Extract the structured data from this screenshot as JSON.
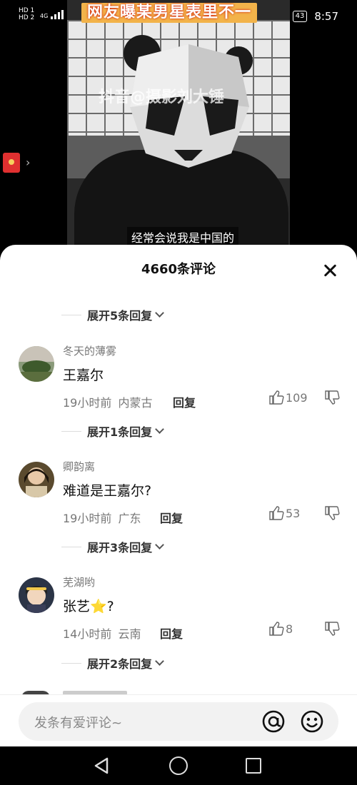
{
  "status_bar": {
    "hd1": "HD 1",
    "hd2": "HD 2",
    "network": "4G",
    "battery": "43",
    "time": "8:57"
  },
  "video": {
    "title_banner": "网友曝某男星表里不一",
    "watermark": "抖音@摄影刘大锤",
    "caption": "经常会说我是中国的"
  },
  "comments_sheet": {
    "header": "4660条评论",
    "expand_labels": [
      "展开5条回复",
      "展开1条回复",
      "展开3条回复",
      "展开2条回复"
    ],
    "comments": [
      {
        "user": "冬天的薄雾",
        "text": "王嘉尔",
        "time": "19小时前",
        "location": "内蒙古",
        "reply": "回复",
        "likes": "109"
      },
      {
        "user": "卿韵离",
        "text": "难道是王嘉尔?",
        "time": "19小时前",
        "location": "广东",
        "reply": "回复",
        "likes": "53"
      },
      {
        "user": "芜湖哟",
        "text": "张艺⭐?",
        "time": "14小时前",
        "location": "云南",
        "reply": "回复",
        "likes": "8"
      }
    ],
    "input_placeholder": "发条有爱评论~"
  },
  "colors": {
    "banner": "#f2b34a",
    "sheet_bg": "#ffffff",
    "input_bg": "#f2f2f2"
  }
}
